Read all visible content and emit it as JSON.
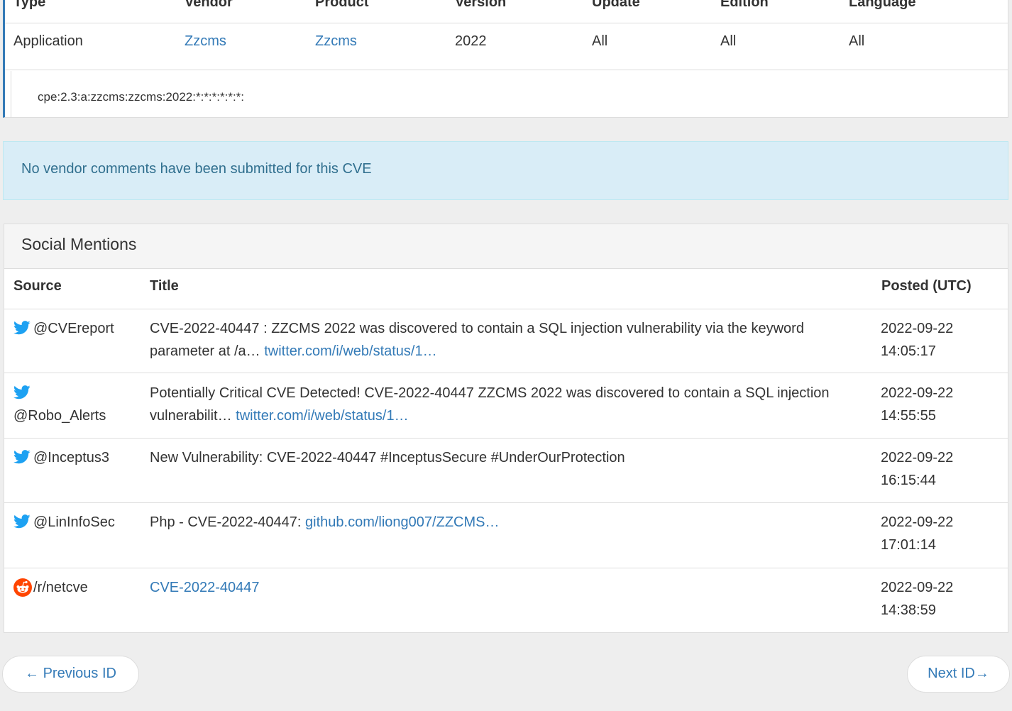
{
  "cpe_table": {
    "headers": [
      "Type",
      "Vendor",
      "Product",
      "Version",
      "Update",
      "Edition",
      "Language"
    ],
    "row": {
      "type": "Application",
      "vendor": "Zzcms",
      "product": "Zzcms",
      "version": "2022",
      "update": "All",
      "edition": "All",
      "language": "All"
    },
    "cpe_string": "cpe:2.3:a:zzcms:zzcms:2022:*:*:*:*:*:*:"
  },
  "vendor_comments": {
    "message": "No vendor comments have been submitted for this CVE"
  },
  "social_mentions": {
    "heading": "Social Mentions",
    "columns": {
      "source": "Source",
      "title": "Title",
      "posted": "Posted (UTC)"
    },
    "rows": [
      {
        "icon": "twitter-icon",
        "source": "@CVEreport",
        "title_text": "CVE-2022-40447 : ZZCMS 2022 was discovered to contain a SQL injection vulnerability via the keyword parameter at /a…",
        "link": "twitter.com/i/web/status/1…",
        "date": "2022-09-22",
        "time": "14:05:17"
      },
      {
        "icon": "twitter-icon",
        "source": "@Robo_Alerts",
        "title_text": "Potentially Critical CVE Detected! CVE-2022-40447 ZZCMS 2022 was discovered to contain a SQL injection vulnerabilit…",
        "link": "twitter.com/i/web/status/1…",
        "date": "2022-09-22",
        "time": "14:55:55"
      },
      {
        "icon": "twitter-icon",
        "source": "@Inceptus3",
        "title_text": "New Vulnerability: CVE-2022-40447 #InceptusSecure #UnderOurProtection",
        "link": "",
        "date": "2022-09-22",
        "time": "16:15:44"
      },
      {
        "icon": "twitter-icon",
        "source": "@LinInfoSec",
        "title_text": "Php - CVE-2022-40447:",
        "link": "github.com/liong007/ZZCMS…",
        "date": "2022-09-22",
        "time": "17:01:14"
      },
      {
        "icon": "reddit-icon",
        "source": "/r/netcve",
        "title_text": "",
        "link": "CVE-2022-40447",
        "date": "2022-09-22",
        "time": "14:38:59"
      }
    ]
  },
  "pager": {
    "previous": "← Previous ID",
    "next": "Next ID→"
  },
  "colors": {
    "link": "#337ab7",
    "alert_bg": "#d9edf7",
    "alert_text": "#31708f",
    "twitter": "#1da1f2",
    "reddit": "#ff4500"
  }
}
